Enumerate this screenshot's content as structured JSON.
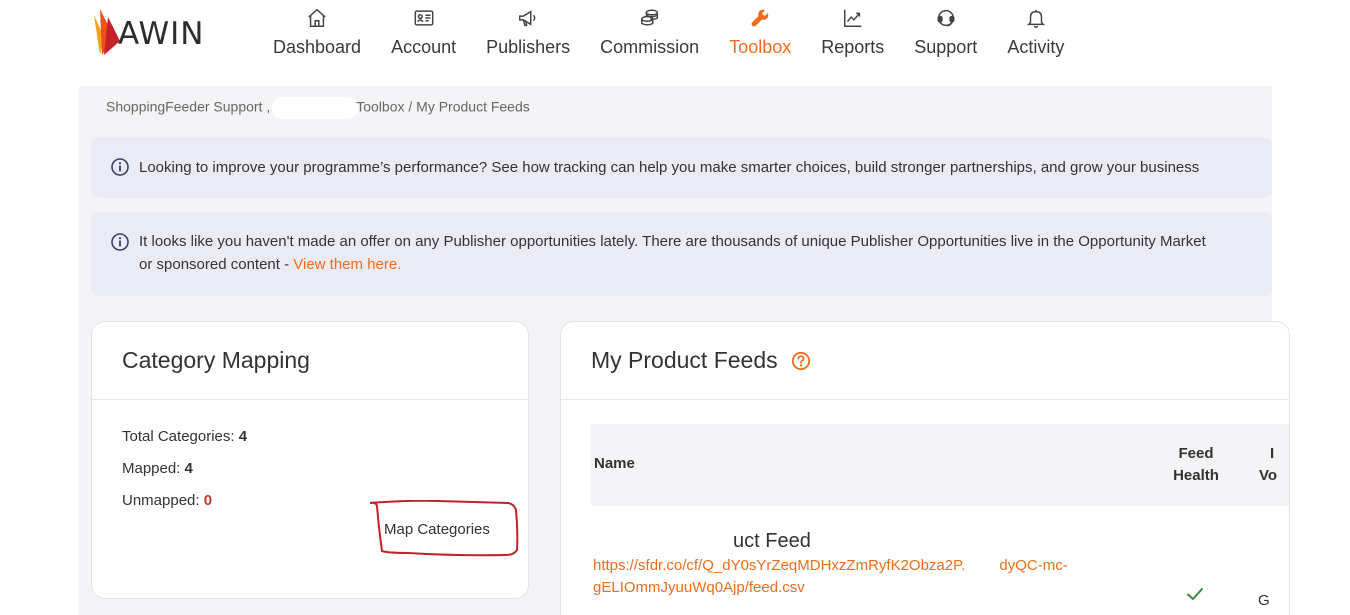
{
  "brand": {
    "name": "AWIN",
    "accent": "#ed6d1f"
  },
  "nav": {
    "items": [
      {
        "label": "Dashboard",
        "icon": "home-icon"
      },
      {
        "label": "Account",
        "icon": "id-card-icon"
      },
      {
        "label": "Publishers",
        "icon": "megaphone-icon"
      },
      {
        "label": "Commission",
        "icon": "coins-icon"
      },
      {
        "label": "Toolbox",
        "icon": "wrench-icon",
        "active": true
      },
      {
        "label": "Reports",
        "icon": "chart-line-icon"
      },
      {
        "label": "Support",
        "icon": "headset-icon"
      },
      {
        "label": "Activity",
        "icon": "bell-icon"
      }
    ]
  },
  "breadcrumb": {
    "part1": "ShoppingFeeder Support ,",
    "part2": "Toolbox / My Product Feeds"
  },
  "notices": {
    "tracking": {
      "text": "Looking to improve your programme’s performance? See how tracking can help you make smarter choices, build stronger partnerships, and grow your business"
    },
    "opportunity": {
      "line1": "It looks like you haven't made an offer on any Publisher opportunities lately. There are thousands of unique Publisher Opportunities live in the Opportunity Market",
      "line2": "or sponsored content - ",
      "link": "View them here."
    }
  },
  "category_mapping": {
    "title": "Category Mapping",
    "total_label": "Total Categories:",
    "total_value": "4",
    "mapped_label": "Mapped:",
    "mapped_value": "4",
    "unmapped_label": "Unmapped:",
    "unmapped_value": "0",
    "button": "Map Categories"
  },
  "product_feeds": {
    "title": "My Product Feeds",
    "columns": {
      "name": "Name",
      "health_1": "Feed",
      "health_2": "Health",
      "cut_1": "I",
      "cut_2": "Vo"
    },
    "feed": {
      "name": "uct Feed",
      "url_1a": "https://sfdr.co/cf/Q_dY0sYrZeqMDHxzZmRyfK2Obza2P.",
      "url_1b": "dyQC-mc-",
      "url_2": "gELIOmmJyuuWq0Ajp/feed.csv",
      "cut_value": "G"
    }
  }
}
